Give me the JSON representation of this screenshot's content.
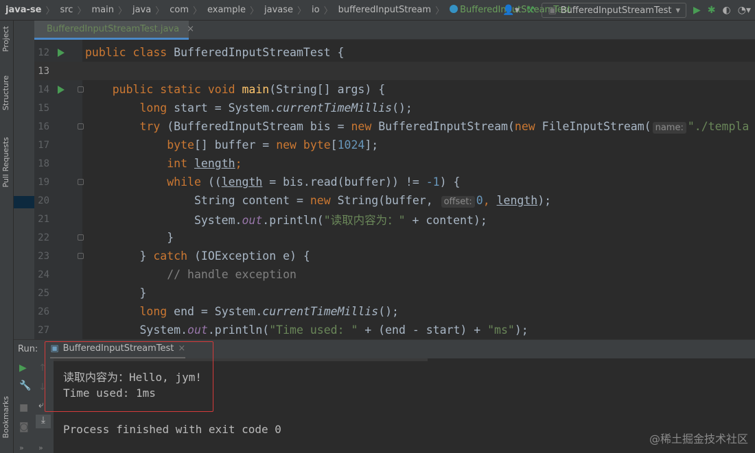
{
  "breadcrumb": [
    "java-se",
    "src",
    "main",
    "java",
    "com",
    "example",
    "javase",
    "io",
    "bufferedInputStream",
    "BufferedInputStreamTest"
  ],
  "toolbar": {
    "run_config": "BufferedInputStreamTest"
  },
  "tab": {
    "label": "BufferedInputStreamTest.java"
  },
  "side_labels": {
    "project": "Project",
    "structure": "Structure",
    "pull_requests": "Pull Requests",
    "bookmarks": "Bookmarks"
  },
  "editor": {
    "current_line": 13,
    "lines": [
      {
        "n": 12,
        "run": true,
        "t": [
          [
            "kw",
            "public class "
          ],
          [
            "",
            "BufferedInputStreamTest {"
          ]
        ]
      },
      {
        "n": 13,
        "t": []
      },
      {
        "n": 14,
        "run": true,
        "fold": true,
        "t": [
          [
            "",
            "    "
          ],
          [
            "kw",
            "public static void "
          ],
          [
            "fn",
            "main"
          ],
          [
            "",
            "(String[] args) {"
          ]
        ]
      },
      {
        "n": 15,
        "t": [
          [
            "",
            "        "
          ],
          [
            "kw",
            "long "
          ],
          [
            "",
            "start = System."
          ],
          [
            "it",
            "currentTimeMillis"
          ],
          [
            "",
            "();"
          ]
        ]
      },
      {
        "n": 16,
        "fold": true,
        "t": [
          [
            "",
            "        "
          ],
          [
            "kw",
            "try "
          ],
          [
            "",
            "(BufferedInputStream bis = "
          ],
          [
            "kw",
            "new "
          ],
          [
            "",
            "BufferedInputStream("
          ],
          [
            "kw",
            "new "
          ],
          [
            "",
            "FileInputStream("
          ],
          [
            "hint",
            "name:"
          ],
          [
            "str",
            "\"./templa"
          ]
        ]
      },
      {
        "n": 17,
        "t": [
          [
            "",
            "            "
          ],
          [
            "kw",
            "byte"
          ],
          [
            "",
            "[] buffer = "
          ],
          [
            "kw",
            "new byte"
          ],
          [
            "",
            "["
          ],
          [
            "num",
            "1024"
          ],
          [
            "",
            "];"
          ]
        ]
      },
      {
        "n": 18,
        "t": [
          [
            "",
            "            "
          ],
          [
            "kw",
            "int "
          ],
          [
            "ul",
            "length"
          ],
          [
            "kw",
            ";"
          ]
        ]
      },
      {
        "n": 19,
        "fold": true,
        "t": [
          [
            "",
            "            "
          ],
          [
            "kw",
            "while "
          ],
          [
            "",
            "(("
          ],
          [
            "ul",
            "length"
          ],
          [
            "",
            " = bis.read(buffer)) != "
          ],
          [
            "num",
            "-1"
          ],
          [
            "",
            ") {"
          ]
        ]
      },
      {
        "n": 20,
        "t": [
          [
            "",
            "                String content = "
          ],
          [
            "kw",
            "new "
          ],
          [
            "",
            "String(buffer, "
          ],
          [
            "hint",
            "offset:"
          ],
          [
            "num",
            "0"
          ],
          [
            "kw",
            ", "
          ],
          [
            "ul",
            "length"
          ],
          [
            "",
            ");"
          ]
        ]
      },
      {
        "n": 21,
        "t": [
          [
            "",
            "                System."
          ],
          [
            "fld",
            "out"
          ],
          [
            "",
            ".println("
          ],
          [
            "str",
            "\"读取内容为：\""
          ],
          [
            "",
            " + content);"
          ]
        ]
      },
      {
        "n": 22,
        "fold": true,
        "t": [
          [
            "",
            "            }"
          ]
        ]
      },
      {
        "n": 23,
        "fold": true,
        "t": [
          [
            "",
            "        } "
          ],
          [
            "kw",
            "catch "
          ],
          [
            "",
            "(IOException e) {"
          ]
        ]
      },
      {
        "n": 24,
        "t": [
          [
            "",
            "            "
          ],
          [
            "cm",
            "// handle exception"
          ]
        ]
      },
      {
        "n": 25,
        "t": [
          [
            "",
            "        }"
          ]
        ]
      },
      {
        "n": 26,
        "t": [
          [
            "",
            "        "
          ],
          [
            "kw",
            "long "
          ],
          [
            "",
            "end = System."
          ],
          [
            "it",
            "currentTimeMillis"
          ],
          [
            "",
            "();"
          ]
        ]
      },
      {
        "n": 27,
        "t": [
          [
            "",
            "        System."
          ],
          [
            "fld",
            "out"
          ],
          [
            "",
            ".println("
          ],
          [
            "str",
            "\"Time used: \""
          ],
          [
            "",
            " + (end - start) + "
          ],
          [
            "str",
            "\"ms\""
          ],
          [
            "",
            ");"
          ]
        ]
      }
    ]
  },
  "run": {
    "label": "Run:",
    "tab": "BufferedInputStreamTest",
    "output": [
      "读取内容为：Hello, jym!",
      "Time used: 1ms",
      "",
      "Process finished with exit code 0"
    ]
  },
  "watermark": "@稀土掘金技术社区",
  "colors": {
    "highlight_box": "#d63b3b",
    "run_green": "#499c54",
    "keyword": "#cc7832",
    "string": "#6a8759"
  }
}
